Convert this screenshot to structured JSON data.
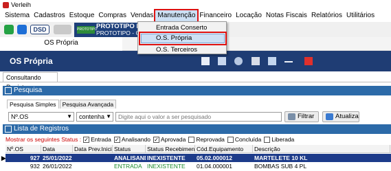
{
  "window": {
    "title": "Verleih"
  },
  "menu": {
    "items": [
      "Sistema",
      "Cadastros",
      "Estoque",
      "Compras",
      "Vendas",
      "Manutenção",
      "Financeiro",
      "Locação",
      "Notas Fiscais",
      "Relatórios",
      "Utilitários"
    ],
    "active": "Manutenção"
  },
  "dropdown": {
    "items": [
      "Entrada Conserto",
      "O.S. Própria",
      "O.S. Terceiros"
    ],
    "selected": "O.S. Própria"
  },
  "prototype": {
    "line1": "PROTOTIPO PR",
    "line2": "PROTOTIPO - CNP",
    "logo_text": "PROTOTIPO"
  },
  "tabs": {
    "active": "OS Própria"
  },
  "form": {
    "title": "OS Própria",
    "subtab": "Consultando Registros",
    "search_section": "Pesquisa",
    "list_section": "Lista de Registros",
    "search_tabs": [
      "Pesquisa Simples",
      "Pesquisa Avançada"
    ],
    "field_select": "Nº.OS",
    "operator_select": "contenha",
    "search_placeholder": "Digite aqui o valor a ser pesquisado",
    "filter_button": "Filtrar",
    "refresh_button": "Atualiza",
    "status_label": "Mostrar os seguintes Status :",
    "status_filters": [
      {
        "label": "Entrada",
        "checked": true
      },
      {
        "label": "Analisando",
        "checked": true
      },
      {
        "label": "Aprovada",
        "checked": true
      },
      {
        "label": "Reprovada",
        "checked": false
      },
      {
        "label": "Concluída",
        "checked": false
      },
      {
        "label": "Liberada",
        "checked": false
      }
    ]
  },
  "table": {
    "columns": [
      "Nº.OS",
      "Data",
      "Data Prev.Inicio",
      "Status",
      "Status Recebimento",
      "Cód.Equipamento",
      "Descrição"
    ],
    "rows": [
      [
        "927",
        "25/01/2022",
        "",
        "ANALISANDO",
        "INEXISTENTE",
        "05.02.000012",
        "MARTELETE 10 KL"
      ],
      [
        "932",
        "26/01/2022",
        "",
        "ENTRADA",
        "INEXISTENTE",
        "01.04.000001",
        "BOMBAS SUB 4 PL"
      ]
    ],
    "selected_row": 0
  },
  "colors": {
    "header_bg": "#1f3d74",
    "section_bar": "#2c6aa8",
    "selected_row": "#1d3b8a",
    "status_green": "#1c8a2d",
    "highlight_red": "#d11"
  }
}
